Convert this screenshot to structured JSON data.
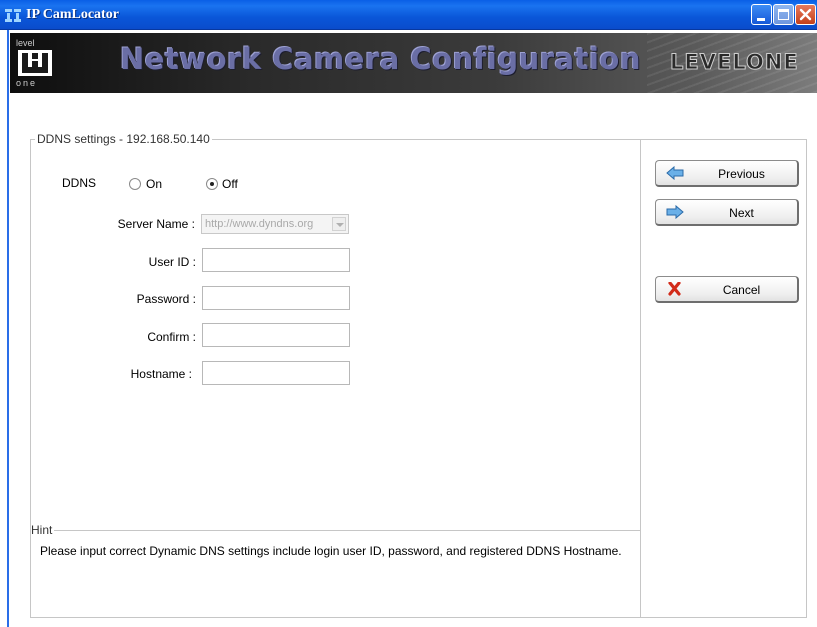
{
  "window": {
    "title": "IP CamLocator"
  },
  "banner": {
    "title": "Network Camera Configuration",
    "brand": "LEVELONE",
    "logo_top": "level",
    "logo_bottom": "one"
  },
  "ddns": {
    "legend": "DDNS settings - 192.168.50.140",
    "label": "DDNS",
    "option_on": "On",
    "option_off": "Off",
    "selected": "Off",
    "server_label": "Server Name :",
    "server_value": "http://www.dyndns.org",
    "user_label": "User ID :",
    "password_label": "Password :",
    "confirm_label": "Confirm :",
    "hostname_label": "Hostname :",
    "user_value": "",
    "password_value": "",
    "confirm_value": "",
    "hostname_value": ""
  },
  "hint": {
    "legend": "Hint",
    "text": "Please input correct Dynamic DNS settings include login user ID, password, and registered DDNS Hostname."
  },
  "buttons": {
    "previous": "Previous",
    "next": "Next",
    "cancel": "Cancel"
  },
  "colors": {
    "titlebar": "#0a56d8",
    "banner_title": "#6a6ea5",
    "arrow_icon": "#6ab0e8",
    "cancel_icon": "#d22b1a"
  }
}
